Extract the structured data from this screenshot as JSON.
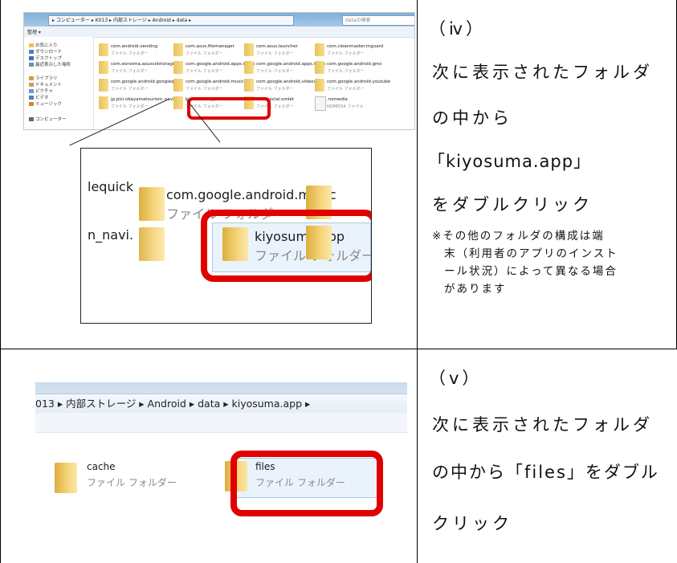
{
  "row1": {
    "step": "（ⅳ）",
    "line1": "次に表示されたフォルダ",
    "line2": "の中から",
    "line3": "「kiyosuma.app」",
    "line4": "をダブルクリック",
    "note": [
      "※その他のフォルダの構成は端",
      "末（利用者のアプリのインスト",
      "ール状況）によって異なる場合",
      "があります"
    ]
  },
  "row2": {
    "step": "（ⅴ）",
    "line1": "次に表示されたフォルダ",
    "line2": "の中から「files」をダブル",
    "line3": "クリック"
  },
  "shot1": {
    "address": "▸ コンピューター ▸ K013 ▸ 内部ストレージ ▸ Android ▸ data ▸",
    "search_placeholder": "dataの検索",
    "toolbar_label": "整理 ▾",
    "sidebar": [
      {
        "label": "お気に入り",
        "icon": "star-icon",
        "color": "#f0c040"
      },
      {
        "label": "ダウンロード",
        "icon": "download-icon",
        "color": "#4a80c0"
      },
      {
        "label": "デスクトップ",
        "icon": "desktop-icon",
        "color": "#3d6fb0"
      },
      {
        "label": "最近表示した場所",
        "icon": "recent-icon",
        "color": "#7a8a9a"
      },
      {
        "label": "ライブラリ",
        "icon": "library-icon",
        "color": "#c9a24a"
      },
      {
        "label": "ドキュメント",
        "icon": "document-icon",
        "color": "#c9a24a"
      },
      {
        "label": "ピクチャ",
        "icon": "picture-icon",
        "color": "#5aa0d0"
      },
      {
        "label": "ビデオ",
        "icon": "video-icon",
        "color": "#5a7fb0"
      },
      {
        "label": "ミュージック",
        "icon": "music-icon",
        "color": "#d08a30"
      },
      {
        "label": "コンピューター",
        "icon": "computer-icon",
        "color": "#5a6a80"
      }
    ],
    "folders": [
      {
        "name": "com.android.vending",
        "type": "ファイル フォルダー"
      },
      {
        "name": "com.asus.filemanager",
        "type": "ファイル フォルダー"
      },
      {
        "name": "com.asus.launcher",
        "type": "ファイル フォルダー"
      },
      {
        "name": "com.cleanmaster.mguard",
        "type": "ファイル フォルダー"
      },
      {
        "name": "com.eonsima.asusvolstorage",
        "type": "ファイル フォルダー"
      },
      {
        "name": "com.google.android.apps.maps",
        "type": "ファイル フォルダー"
      },
      {
        "name": "com.google.android.apps.maps",
        "type": "ファイル フォルダー"
      },
      {
        "name": "com.google.android.gms",
        "type": "ファイル フォルダー"
      },
      {
        "name": "com.google.android.googlequick",
        "type": "ファイル フォルダー"
      },
      {
        "name": "com.google.android.music",
        "type": "ファイル フォルダー"
      },
      {
        "name": "com.google.android.videos",
        "type": "ファイル フォルダー"
      },
      {
        "name": "com.google.android.youtube",
        "type": "ファイル フォルダー"
      },
      {
        "name": "jp.pici.okayamatourism_navi",
        "type": "ファイル フォルダー"
      },
      {
        "name": "kiyosuma.app",
        "type": "ファイル フォルダー"
      },
      {
        "name": "mobisocial.omlet",
        "type": "ファイル フォルダー"
      },
      {
        "name": ".nomedia",
        "type": "NOMEDIA ファイル"
      }
    ]
  },
  "zoom": {
    "partial1": "lequick",
    "partial2": "n_navi.",
    "folder1_name": "com.google.android.music",
    "folder1_type": "ファイル フォルダー",
    "folder2_name": "kiyosuma.app",
    "folder2_type": "ファイル フォルダー"
  },
  "shot2": {
    "address": "013 ▸ 内部ストレージ ▸ Android ▸ data ▸ kiyosuma.app ▸",
    "folders": [
      {
        "name": "cache",
        "type": "ファイル フォルダー"
      },
      {
        "name": "files",
        "type": "ファイル フォルダー"
      }
    ]
  }
}
